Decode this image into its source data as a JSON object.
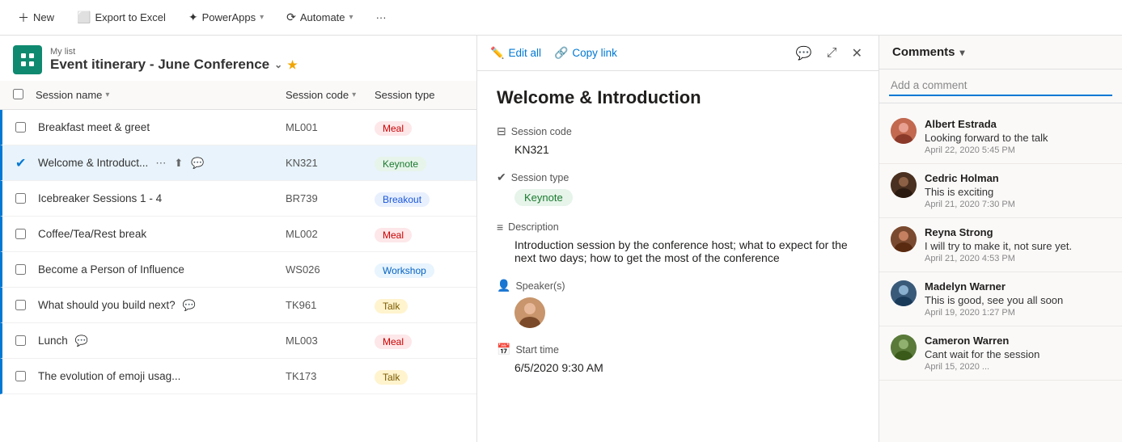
{
  "toolbar": {
    "new_label": "New",
    "export_label": "Export to Excel",
    "powerapps_label": "PowerApps",
    "automate_label": "Automate",
    "more_label": "···"
  },
  "list": {
    "my_list_label": "My list",
    "title": "Event itinerary - June Conference",
    "col_name": "Session name",
    "col_code": "Session code",
    "col_type": "Session type",
    "rows": [
      {
        "id": 1,
        "name": "Breakfast meet & greet",
        "code": "ML001",
        "type": "Meal",
        "badge": "meal",
        "selected": false,
        "bar": true
      },
      {
        "id": 2,
        "name": "Welcome & Introduct...",
        "code": "KN321",
        "type": "Keynote",
        "badge": "keynote",
        "selected": true,
        "bar": true
      },
      {
        "id": 3,
        "name": "Icebreaker Sessions 1 - 4",
        "code": "BR739",
        "type": "Breakout",
        "badge": "breakout",
        "selected": false,
        "bar": true
      },
      {
        "id": 4,
        "name": "Coffee/Tea/Rest break",
        "code": "ML002",
        "type": "Meal",
        "badge": "meal",
        "selected": false,
        "bar": true
      },
      {
        "id": 5,
        "name": "Become a Person of Influence",
        "code": "WS026",
        "type": "Workshop",
        "badge": "workshop",
        "selected": false,
        "bar": true
      },
      {
        "id": 6,
        "name": "What should you build next?",
        "code": "TK961",
        "type": "Talk",
        "badge": "talk",
        "selected": false,
        "bar": true
      },
      {
        "id": 7,
        "name": "Lunch",
        "code": "ML003",
        "type": "Meal",
        "badge": "meal",
        "selected": false,
        "bar": true
      },
      {
        "id": 8,
        "name": "The evolution of emoji usag...",
        "code": "TK173",
        "type": "Talk",
        "badge": "talk",
        "selected": false,
        "bar": true
      }
    ]
  },
  "detail": {
    "edit_all_label": "Edit all",
    "copy_link_label": "Copy link",
    "title": "Welcome & Introduction",
    "session_code_label": "Session code",
    "session_code_value": "KN321",
    "session_type_label": "Session type",
    "session_type_value": "Keynote",
    "description_label": "Description",
    "description_value": "Introduction session by the conference host; what to expect for the next two days; how to get the most of the conference",
    "speakers_label": "Speaker(s)",
    "start_time_label": "Start time",
    "start_time_value": "6/5/2020 9:30 AM"
  },
  "comments": {
    "header_label": "Comments",
    "add_placeholder": "Add a comment",
    "items": [
      {
        "id": 1,
        "name": "Albert Estrada",
        "text": "Looking forward to the talk",
        "date": "April 22, 2020 5:45 PM",
        "av_class": "av-albert"
      },
      {
        "id": 2,
        "name": "Cedric Holman",
        "text": "This is exciting",
        "date": "April 21, 2020 7:30 PM",
        "av_class": "av-cedric"
      },
      {
        "id": 3,
        "name": "Reyna Strong",
        "text": "I will try to make it, not sure yet.",
        "date": "April 21, 2020 4:53 PM",
        "av_class": "av-reyna"
      },
      {
        "id": 4,
        "name": "Madelyn Warner",
        "text": "This is good, see you all soon",
        "date": "April 19, 2020 1:27 PM",
        "av_class": "av-madelyn"
      },
      {
        "id": 5,
        "name": "Cameron Warren",
        "text": "Cant wait for the session",
        "date": "April 15, 2020 ...",
        "av_class": "av-cameron"
      }
    ]
  }
}
